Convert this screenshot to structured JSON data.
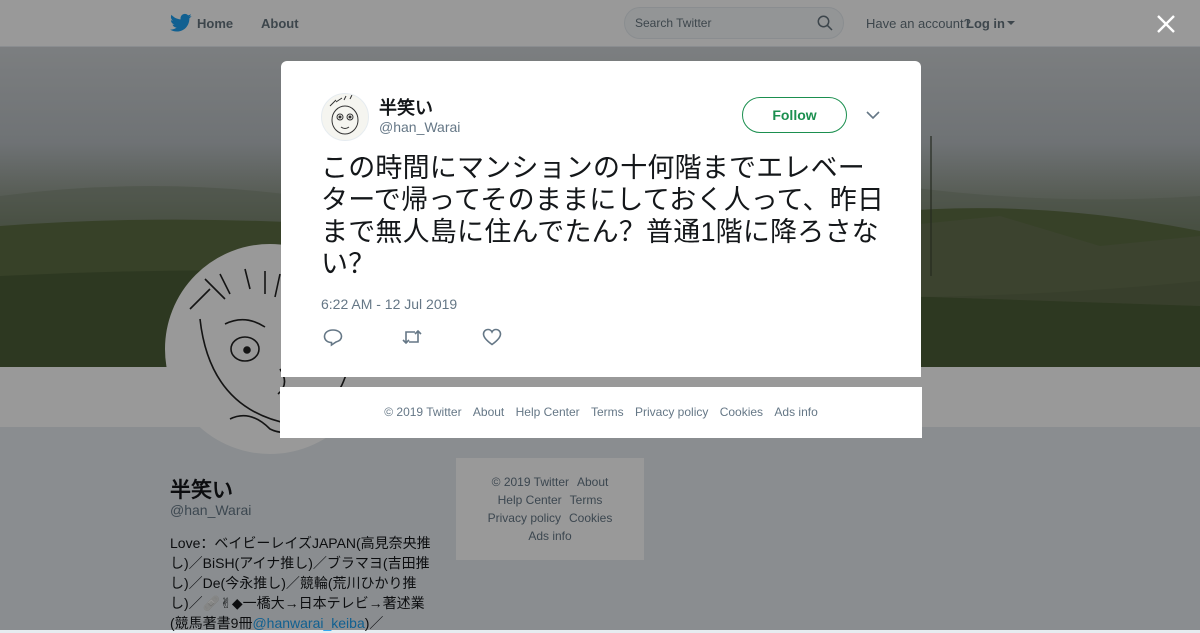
{
  "nav": {
    "home_label": "Home",
    "about_label": "About",
    "search_placeholder": "Search Twitter",
    "have_account": "Have an account?",
    "login_label": "Log in"
  },
  "profile": {
    "name": "半笑い",
    "handle": "@han_Warai",
    "bio_part1": "Love：ベイビーレイズJAPAN(高見奈央推し)／BiSH(アイナ推し)／ブラマヨ(吉田推し)／De(今永推し)／競輪(荒川ひかり推し)／🩹✌◆一橋大→日本テレビ→著述業(競馬著書9冊",
    "bio_mention": "@hanwarai_keiba",
    "bio_part2": ")／"
  },
  "side_footer": {
    "items": [
      "© 2019 Twitter",
      "About",
      "Help Center",
      "Terms",
      "Privacy policy",
      "Cookies",
      "Ads info"
    ]
  },
  "tweet": {
    "author_name": "半笑い",
    "author_handle": "@han_Warai",
    "follow_label": "Follow",
    "text": "この時間にマンションの十何階までエレベーターで帰ってそのままにしておく人って、昨日まで無人島に住んでたん？普通1階に降ろさない？",
    "timestamp": "6:22 AM - 12 Jul 2019"
  },
  "modal_footer": {
    "items": [
      "© 2019 Twitter",
      "About",
      "Help Center",
      "Terms",
      "Privacy policy",
      "Cookies",
      "Ads info"
    ]
  },
  "colors": {
    "twitter_blue": "#1da1f2",
    "follow_green": "#1b8f4f",
    "text_gray": "#657786"
  },
  "icons": [
    "twitter-bird-icon",
    "search-icon",
    "caret-down-icon",
    "close-icon",
    "chevron-down-icon",
    "reply-icon",
    "retweet-icon",
    "like-icon"
  ]
}
